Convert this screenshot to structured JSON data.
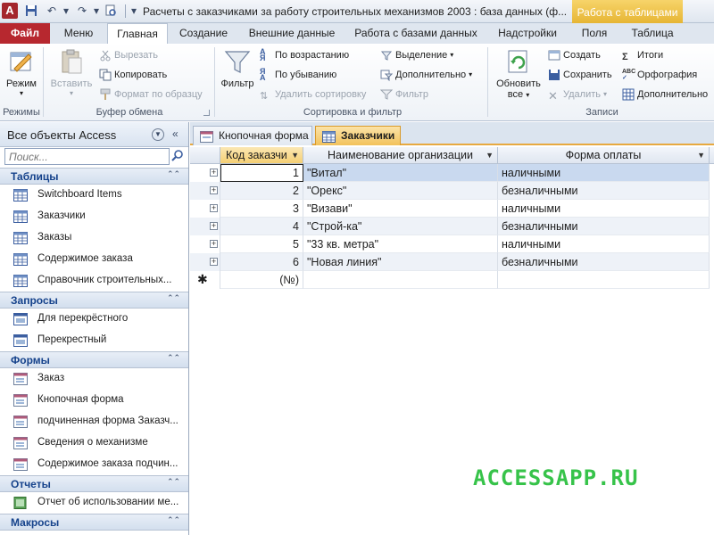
{
  "titlebar": {
    "app_icon": "A",
    "title": "Расчеты с заказчиками за работу строительных механизмов 2003 : база данных (ф...",
    "context_tab": "Работа с таблицами",
    "qat_icons": [
      "save-icon",
      "undo-icon",
      "redo-icon",
      "print-preview-icon",
      "customize-qat-icon"
    ]
  },
  "ribbon_tabs": [
    "Файл",
    "Меню",
    "Главная",
    "Создание",
    "Внешние данные",
    "Работа с базами данных",
    "Надстройки",
    "Поля",
    "Таблица"
  ],
  "ribbon": {
    "view": {
      "label": "Режим",
      "group": "Режимы"
    },
    "clipboard": {
      "paste": "Вставить",
      "cut": "Вырезать",
      "copy": "Копировать",
      "format_painter": "Формат по образцу",
      "group": "Буфер обмена"
    },
    "sort_filter": {
      "filter": "Фильтр",
      "asc": "По возрастанию",
      "desc": "По убыванию",
      "remove_sort": "Удалить сортировку",
      "selection": "Выделение",
      "advanced": "Дополнительно",
      "toggle_filter": "Фильтр",
      "group": "Сортировка и фильтр"
    },
    "records": {
      "refresh_1": "Обновить",
      "refresh_2": "все",
      "new": "Создать",
      "save": "Сохранить",
      "delete": "Удалить",
      "totals": "Итоги",
      "spelling": "Орфография",
      "more": "Дополнительно",
      "group": "Записи"
    }
  },
  "nav": {
    "title": "Все объекты Access",
    "search_placeholder": "Поиск...",
    "sections": [
      {
        "label": "Таблицы",
        "items": [
          "Switchboard Items",
          "Заказчики",
          "Заказы",
          "Содержимое заказа",
          "Справочник строительных..."
        ]
      },
      {
        "label": "Запросы",
        "items": [
          "Для перекрёстного",
          "Перекрестный"
        ]
      },
      {
        "label": "Формы",
        "items": [
          "Заказ",
          "Кнопочная форма",
          "подчиненная форма Заказч...",
          "Сведения о механизме",
          "Содержимое заказа подчин..."
        ]
      },
      {
        "label": "Отчеты",
        "items": [
          "Отчет об использовании ме..."
        ]
      },
      {
        "label": "Макросы",
        "items": []
      }
    ]
  },
  "doc_tabs": [
    "Кнопочная форма",
    "Заказчики"
  ],
  "table": {
    "columns": [
      "Код заказчи",
      "Наименование организации",
      "Форма оплаты"
    ],
    "rows": [
      [
        "1",
        "\"Витал\"",
        "наличными"
      ],
      [
        "2",
        "\"Орекс\"",
        "безналичными"
      ],
      [
        "3",
        "\"Визави\"",
        "наличными"
      ],
      [
        "4",
        "\"Строй-ка\"",
        "безналичными"
      ],
      [
        "5",
        "\"33 кв. метра\"",
        "наличными"
      ],
      [
        "6",
        "\"Новая линия\"",
        "безналичными"
      ]
    ],
    "new_row_id": "(№)"
  },
  "watermark": "ACCESSAPP.RU",
  "colors": {
    "file_tab": "#b7282f",
    "context_tab": "#e6b534",
    "nav_section": "#15428b",
    "watermark": "#37c34a"
  }
}
